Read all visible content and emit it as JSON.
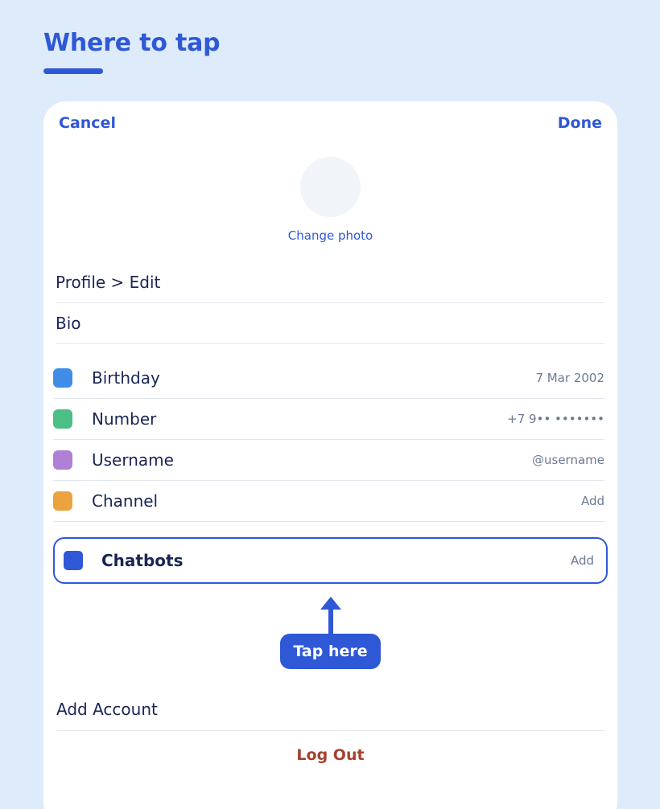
{
  "heading": {
    "title": "Where to tap"
  },
  "nav": {
    "cancel_label": "Cancel",
    "done_label": "Done"
  },
  "profile": {
    "change_photo_label": "Change photo"
  },
  "fields": {
    "name": "Profile > Edit",
    "bio": "Bio"
  },
  "rows": [
    {
      "label": "Birthday",
      "value": "7 Mar 2002",
      "color": "#3f8de6"
    },
    {
      "label": "Number",
      "value": "+7 9•• •••••••",
      "color": "#4bbf85"
    },
    {
      "label": "Username",
      "value": "@username",
      "color": "#b07fd6"
    },
    {
      "label": "Channel",
      "value": "Add",
      "color": "#eaa33e"
    }
  ],
  "highlight_row": {
    "label": "Chatbots",
    "value": "Add",
    "color": "#2f58d6"
  },
  "callout": {
    "label": "Tap here"
  },
  "account": {
    "add_account_label": "Add Account",
    "logout_label": "Log Out"
  },
  "colors": {
    "accent": "#2f58d6",
    "background": "#deebfa",
    "danger": "#a3432e"
  }
}
